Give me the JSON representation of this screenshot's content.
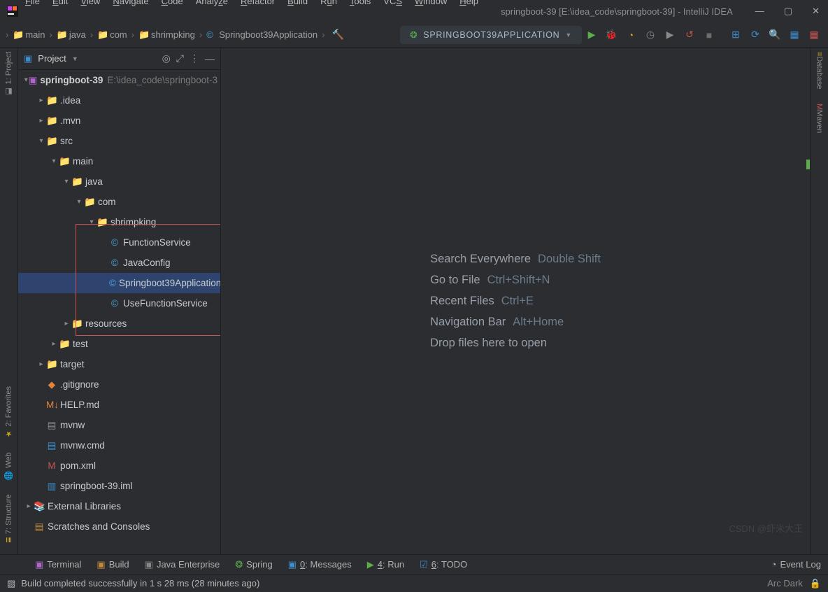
{
  "window_title": "springboot-39 [E:\\idea_code\\springboot-39] - IntelliJ IDEA",
  "menu": [
    "File",
    "Edit",
    "View",
    "Navigate",
    "Code",
    "Analyze",
    "Refactor",
    "Build",
    "Run",
    "Tools",
    "VCS",
    "Window",
    "Help"
  ],
  "menu_mn": [
    "F",
    "E",
    "V",
    "N",
    "C",
    "",
    "R",
    "B",
    "R",
    "T",
    "",
    "W",
    "H"
  ],
  "breadcrumbs": [
    "main",
    "java",
    "com",
    "shrimpking",
    "Springboot39Application"
  ],
  "run_config": "SPRINGBOOT39APPLICATION",
  "project_panel_title": "Project",
  "tree": {
    "root": {
      "name": "springboot-39",
      "path": "E:\\idea_code\\springboot-3"
    },
    "idea": ".idea",
    "mvn": ".mvn",
    "src": "src",
    "main": "main",
    "java": "java",
    "com": "com",
    "pkg": "shrimpking",
    "files": [
      "FunctionService",
      "JavaConfig",
      "Springboot39Application",
      "UseFunctionService"
    ],
    "resources": "resources",
    "test": "test",
    "target": "target",
    "gitignore": ".gitignore",
    "help": "HELP.md",
    "mvnw": "mvnw",
    "mvnwcmd": "mvnw.cmd",
    "pom": "pom.xml",
    "iml": "springboot-39.iml",
    "ext": "External Libraries",
    "scratch": "Scratches and Consoles"
  },
  "hints": [
    {
      "label": "Search Everywhere",
      "shortcut": "Double Shift"
    },
    {
      "label": "Go to File",
      "shortcut": "Ctrl+Shift+N"
    },
    {
      "label": "Recent Files",
      "shortcut": "Ctrl+E"
    },
    {
      "label": "Navigation Bar",
      "shortcut": "Alt+Home"
    },
    {
      "label": "Drop files here to open",
      "shortcut": ""
    }
  ],
  "tool_strip": [
    {
      "label": "Terminal"
    },
    {
      "label": "Build"
    },
    {
      "label": "Java Enterprise"
    },
    {
      "label": "Spring"
    },
    {
      "label": "0: Messages",
      "mn": "0"
    },
    {
      "label": "4: Run",
      "mn": "4"
    },
    {
      "label": "6: TODO",
      "mn": "6"
    }
  ],
  "event_log": "Event Log",
  "status": "Build completed successfully in 1 s 28 ms (28 minutes ago)",
  "theme": "Arc Dark",
  "left_tabs": [
    "1: Project",
    "2: Favorites",
    "Web",
    "7: Structure"
  ],
  "right_tabs": [
    "Database",
    "Maven"
  ],
  "watermark": "CSDN @虾米大王"
}
